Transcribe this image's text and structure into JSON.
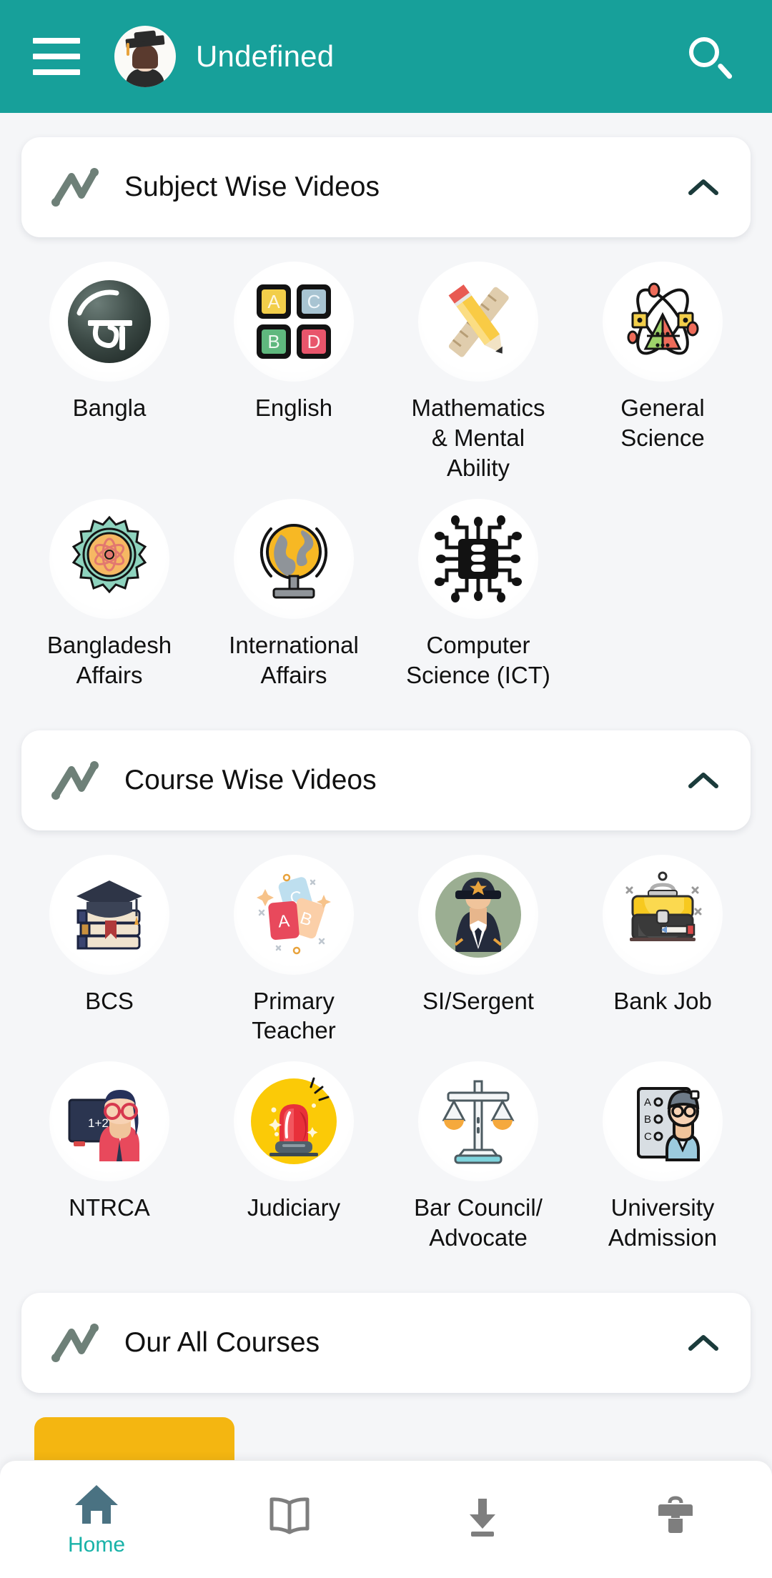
{
  "theme": {
    "primary": "#17A09A",
    "accent_teal": "#18B2A8",
    "background": "#F5F6F8",
    "card": "#FFFFFF",
    "yellow": "#F4B611",
    "icon_gray": "#6E8078",
    "home_icon": "#4A7282"
  },
  "header": {
    "menu_icon": "hamburger-icon",
    "avatar_icon": "graduate-avatar",
    "title": "Undefined",
    "search_icon": "search-icon"
  },
  "sections": [
    {
      "id": "subject-wise-videos",
      "icon": "trend-line-icon",
      "title": "Subject Wise Videos",
      "toggle_icon": "chevron-up-icon",
      "expanded": true,
      "items": [
        {
          "label": "Bangla",
          "icon": "bangla-letter-icon"
        },
        {
          "label": "English",
          "icon": "abcd-blocks-icon"
        },
        {
          "label": "Mathematics & Mental Ability",
          "icon": "ruler-pencil-icon"
        },
        {
          "label": "General Science",
          "icon": "atom-icon"
        },
        {
          "label": "Bangladesh Affairs",
          "icon": "gear-atom-icon"
        },
        {
          "label": "International Affairs",
          "icon": "globe-stand-icon"
        },
        {
          "label": "Computer Science (ICT)",
          "icon": "microchip-icon"
        }
      ]
    },
    {
      "id": "course-wise-videos",
      "icon": "trend-line-icon",
      "title": "Course Wise Videos",
      "toggle_icon": "chevron-up-icon",
      "expanded": true,
      "items": [
        {
          "label": "BCS",
          "icon": "graduation-books-icon"
        },
        {
          "label": "Primary Teacher",
          "icon": "abc-cards-icon"
        },
        {
          "label": "SI/Sergent",
          "icon": "police-officer-icon"
        },
        {
          "label": "Bank Job",
          "icon": "briefcase-books-icon"
        },
        {
          "label": "NTRCA",
          "icon": "teacher-board-icon"
        },
        {
          "label": "Judiciary",
          "icon": "siren-icon"
        },
        {
          "label": "Bar Council/ Advocate",
          "icon": "scales-icon"
        },
        {
          "label": "University Admission",
          "icon": "student-exam-icon"
        }
      ]
    },
    {
      "id": "our-all-courses",
      "icon": "trend-line-icon",
      "title": "Our All Courses",
      "toggle_icon": "chevron-up-icon",
      "expanded": true,
      "items": []
    }
  ],
  "bottom_nav": {
    "items": [
      {
        "label": "Home",
        "icon": "home-icon",
        "active": true
      },
      {
        "label": "",
        "icon": "book-icon",
        "active": false
      },
      {
        "label": "",
        "icon": "download-icon",
        "active": false
      },
      {
        "label": "",
        "icon": "briefcase-icon",
        "active": false
      }
    ]
  }
}
